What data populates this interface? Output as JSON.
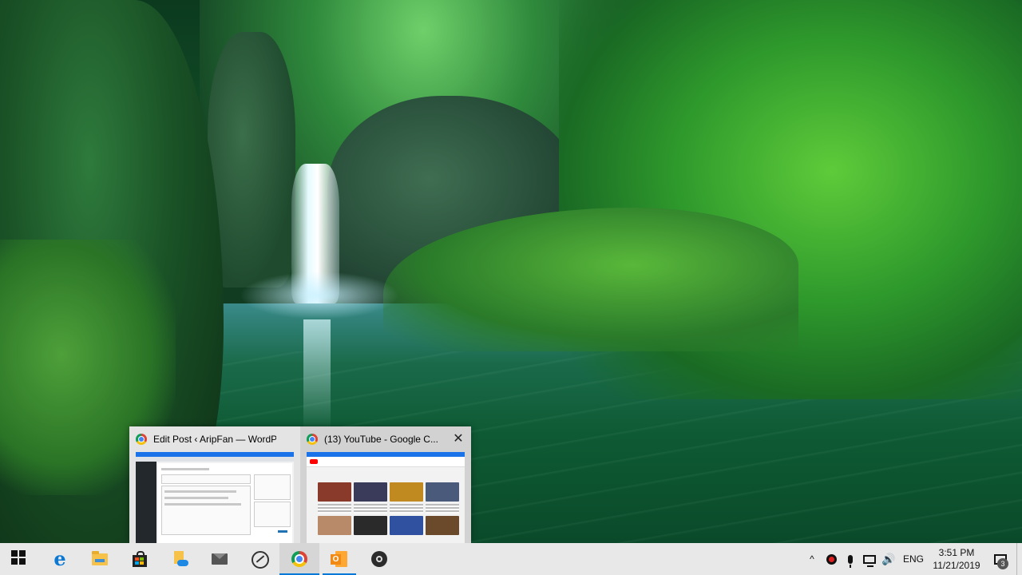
{
  "popup": {
    "windows": [
      {
        "title": "Edit Post ‹ AripFan — WordPre...",
        "app": "chrome"
      },
      {
        "title": "(13) YouTube - Google C...",
        "app": "chrome",
        "close_label": "✕"
      }
    ]
  },
  "taskbar": {
    "pinned": [
      {
        "name": "start",
        "icon": "windows-logo-icon"
      },
      {
        "name": "edge",
        "icon": "edge-icon",
        "glyph": "e"
      },
      {
        "name": "file-explorer",
        "icon": "folder-icon"
      },
      {
        "name": "store",
        "icon": "store-bag-icon"
      },
      {
        "name": "onedrive-file",
        "icon": "cloud-file-icon"
      },
      {
        "name": "mail",
        "icon": "mail-icon"
      },
      {
        "name": "dashboard",
        "icon": "gauge-icon"
      },
      {
        "name": "chrome",
        "icon": "chrome-icon",
        "state": "active"
      },
      {
        "name": "outlook",
        "icon": "outlook-icon",
        "glyph": "O",
        "state": "running"
      },
      {
        "name": "obs",
        "icon": "obs-icon"
      }
    ],
    "tray": {
      "chevron": "^",
      "language": "ENG",
      "time": "3:51 PM",
      "date": "11/21/2019",
      "notification_count": "3",
      "volume_glyph": "🔊"
    }
  },
  "colors": {
    "taskbar_bg": "#e8e8e8",
    "accent": "#0078d7",
    "popup_bg": "#e4e4e4"
  }
}
